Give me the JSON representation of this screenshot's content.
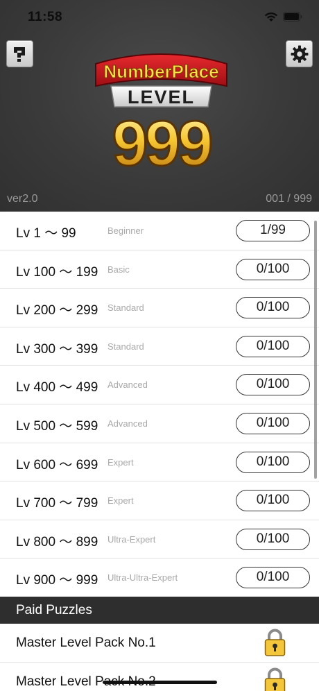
{
  "status_bar": {
    "time": "11:58"
  },
  "header": {
    "logo_title": "NumberPlace",
    "logo_level_word": "LEVEL",
    "logo_number": "999",
    "version": "ver2.0",
    "progress": "001 / 999"
  },
  "levels": [
    {
      "range": "Lv 1 ～ 99",
      "difficulty": "Beginner",
      "count": "1/99"
    },
    {
      "range": "Lv 100 ～ 199",
      "difficulty": "Basic",
      "count": "0/100"
    },
    {
      "range": "Lv 200 ～ 299",
      "difficulty": "Standard",
      "count": "0/100"
    },
    {
      "range": "Lv 300 ～ 399",
      "difficulty": "Standard",
      "count": "0/100"
    },
    {
      "range": "Lv 400 ～ 499",
      "difficulty": "Advanced",
      "count": "0/100"
    },
    {
      "range": "Lv 500 ～ 599",
      "difficulty": "Advanced",
      "count": "0/100"
    },
    {
      "range": "Lv 600 ～ 699",
      "difficulty": "Expert",
      "count": "0/100"
    },
    {
      "range": "Lv 700 ～ 799",
      "difficulty": "Expert",
      "count": "0/100"
    },
    {
      "range": "Lv 800 ～ 899",
      "difficulty": "Ultra-Expert",
      "count": "0/100"
    },
    {
      "range": "Lv 900 ～ 999",
      "difficulty": "Ultra-Ultra-Expert",
      "count": "0/100"
    }
  ],
  "paid": {
    "title": "Paid Puzzles",
    "packs": [
      {
        "label": "Master Level Pack No.1",
        "icon": "lock-icon"
      },
      {
        "label": "Master Level Pack No.2",
        "icon": "lock-icon"
      }
    ]
  },
  "colors": {
    "header_bg": "#3a3a3a",
    "section_bg": "#2e2e2e",
    "logo_red": "#c8141b",
    "logo_gold": "#f2c12e"
  },
  "icons": {
    "help": "help-icon",
    "settings": "gear-icon",
    "lock": "lock-icon"
  }
}
